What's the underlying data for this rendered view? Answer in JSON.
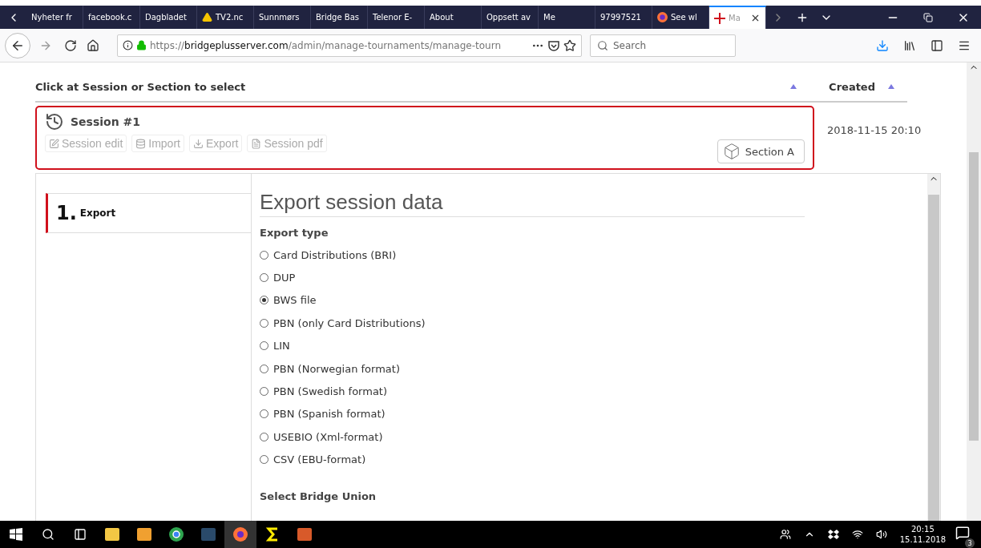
{
  "browser": {
    "tabs": [
      {
        "label": "Nyheter fr",
        "selected": false,
        "kind": "plain"
      },
      {
        "label": "facebook.c",
        "selected": false,
        "kind": "plain"
      },
      {
        "label": "Dagbladet",
        "selected": false,
        "kind": "plain"
      },
      {
        "label": "TV2.nc",
        "selected": false,
        "kind": "warning"
      },
      {
        "label": "Sunnmørs",
        "selected": false,
        "kind": "plain"
      },
      {
        "label": "Bridge Bas",
        "selected": false,
        "kind": "plain"
      },
      {
        "label": "Telenor E-",
        "selected": false,
        "kind": "plain"
      },
      {
        "label": "About",
        "selected": false,
        "kind": "plain"
      },
      {
        "label": "Oppsett av",
        "selected": false,
        "kind": "plain"
      },
      {
        "label": "Me",
        "selected": false,
        "kind": "plain"
      },
      {
        "label": "97997521",
        "selected": false,
        "kind": "plain"
      },
      {
        "label": "See wl",
        "selected": false,
        "kind": "globe"
      },
      {
        "label": "Ma",
        "selected": true,
        "kind": "cross"
      }
    ],
    "url": {
      "scheme": "https://",
      "domain": "bridgeplusserver.com",
      "path": "/admin/manage-tournaments/manage-tourn"
    },
    "search": {
      "placeholder": "Search"
    }
  },
  "page": {
    "instruction": "Click at Session or Section to select",
    "created_header": "Created",
    "session": {
      "title": "Session #1",
      "selected": true,
      "actions": [
        {
          "label": "Session edit",
          "kind": "edit",
          "disabled": true
        },
        {
          "label": "Import",
          "kind": "database",
          "disabled": true
        },
        {
          "label": "Export",
          "kind": "download",
          "disabled": true
        },
        {
          "label": "Session pdf",
          "kind": "pdf",
          "disabled": true
        }
      ],
      "section_button": "Section A",
      "created": "2018-11-15 20:10"
    },
    "steps": [
      {
        "number": "1.",
        "label": "Export",
        "selected": true
      }
    ],
    "export": {
      "title": "Export session data",
      "type_heading": "Export type",
      "options": [
        {
          "label": "Card Distributions (BRI)",
          "selected": false
        },
        {
          "label": "DUP",
          "selected": false
        },
        {
          "label": "BWS file",
          "selected": true
        },
        {
          "label": "PBN (only Card Distributions)",
          "selected": false
        },
        {
          "label": "LIN",
          "selected": false
        },
        {
          "label": "PBN (Norwegian format)",
          "selected": false
        },
        {
          "label": "PBN (Swedish format)",
          "selected": false
        },
        {
          "label": "PBN (Spanish format)",
          "selected": false
        },
        {
          "label": "USEBIO (Xml-format)",
          "selected": false
        },
        {
          "label": "CSV (EBU-format)",
          "selected": false
        }
      ],
      "union_heading": "Select Bridge Union"
    }
  },
  "taskbar": {
    "time": "20:15",
    "date": "15.11.2018",
    "notifications": "3"
  }
}
